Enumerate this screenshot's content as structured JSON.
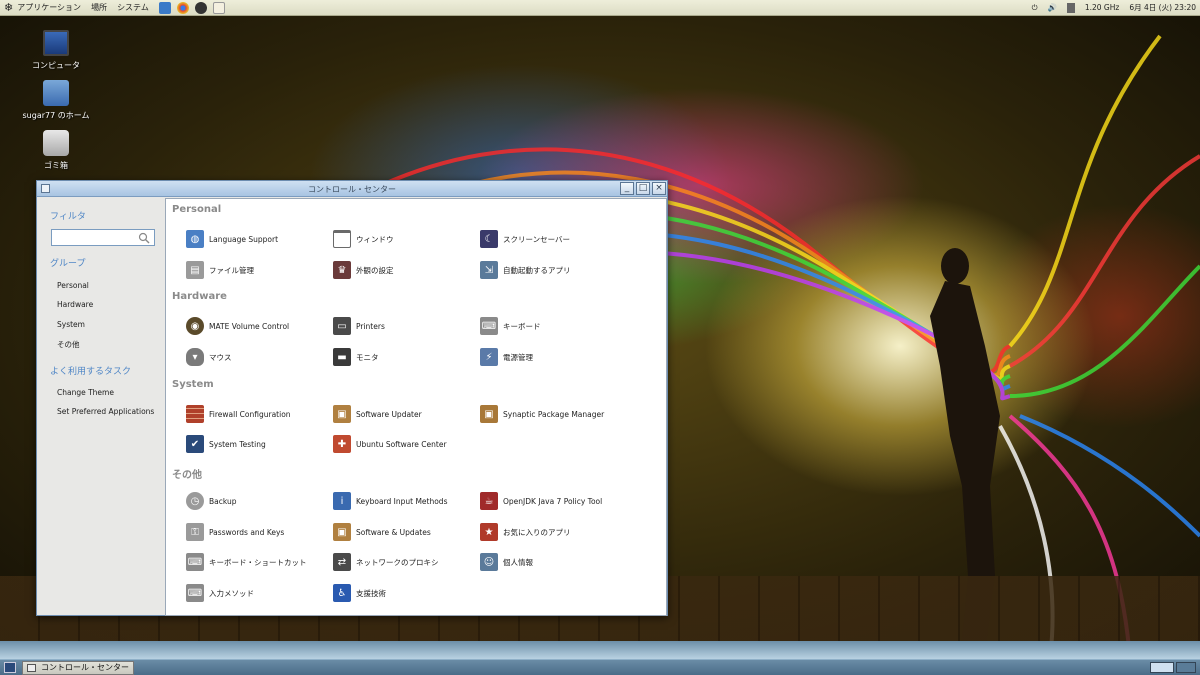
{
  "top_panel": {
    "menus": [
      "アプリケーション",
      "場所",
      "システム"
    ],
    "cpu": "1.20 GHz",
    "datetime": "6月 4日 (火) 23:20"
  },
  "desktop": {
    "icons": [
      {
        "label": "コンピュータ"
      },
      {
        "label": "sugar77 のホーム"
      },
      {
        "label": "ゴミ箱"
      }
    ]
  },
  "window": {
    "title": "コントロール・センター",
    "sidebar": {
      "filter_heading": "フィルタ",
      "filter_value": "",
      "group_heading": "グループ",
      "groups": [
        "Personal",
        "Hardware",
        "System",
        "その他"
      ],
      "tasks_heading": "よく利用するタスク",
      "tasks": [
        "Change Theme",
        "Set Preferred Applications"
      ]
    },
    "categories": [
      {
        "name": "Personal",
        "items": [
          {
            "label": "Language Support",
            "icon": "globe-icon",
            "color": "#4a7fc4"
          },
          {
            "label": "ウィンドウ",
            "icon": "window-icon",
            "color": "#6a6a6a"
          },
          {
            "label": "スクリーンセーバー",
            "icon": "screensaver-icon",
            "color": "#3a3a6a"
          },
          {
            "label": "ファイル管理",
            "icon": "file-cabinet-icon",
            "color": "#9a9a9a"
          },
          {
            "label": "外観の設定",
            "icon": "appearance-icon",
            "color": "#6a3a3a"
          },
          {
            "label": "自動起動するアプリ",
            "icon": "startup-apps-icon",
            "color": "#5a7a9a"
          }
        ]
      },
      {
        "name": "Hardware",
        "items": [
          {
            "label": "MATE Volume Control",
            "icon": "speaker-icon",
            "color": "#5a4a2a"
          },
          {
            "label": "Printers",
            "icon": "printer-icon",
            "color": "#4a4a4a"
          },
          {
            "label": "キーボード",
            "icon": "keyboard-icon",
            "color": "#8a8a8a"
          },
          {
            "label": "マウス",
            "icon": "mouse-icon",
            "color": "#7a7a7a"
          },
          {
            "label": "モニタ",
            "icon": "monitor-icon",
            "color": "#3a3a3a"
          },
          {
            "label": "電源管理",
            "icon": "power-management-icon",
            "color": "#5a7aa8"
          }
        ]
      },
      {
        "name": "System",
        "items": [
          {
            "label": "Firewall Configuration",
            "icon": "firewall-icon",
            "color": "#b0402a"
          },
          {
            "label": "Software Updater",
            "icon": "software-updater-icon",
            "color": "#b08040"
          },
          {
            "label": "Synaptic Package Manager",
            "icon": "package-icon",
            "color": "#a87838"
          },
          {
            "label": "System Testing",
            "icon": "system-testing-icon",
            "color": "#2a4a7a"
          },
          {
            "label": "Ubuntu Software Center",
            "icon": "software-center-icon",
            "color": "#c04a30"
          }
        ]
      },
      {
        "name": "その他",
        "items": [
          {
            "label": "Backup",
            "icon": "backup-icon",
            "color": "#9a9a9a"
          },
          {
            "label": "Keyboard Input Methods",
            "icon": "info-icon",
            "color": "#3a6ab0"
          },
          {
            "label": "OpenJDK Java 7 Policy Tool",
            "icon": "java-icon",
            "color": "#a02a2a"
          },
          {
            "label": "Passwords and Keys",
            "icon": "keys-icon",
            "color": "#9a9a9a"
          },
          {
            "label": "Software & Updates",
            "icon": "software-updates-icon",
            "color": "#b08040"
          },
          {
            "label": "お気に入りのアプリ",
            "icon": "favorite-apps-icon",
            "color": "#b03a2a"
          },
          {
            "label": "キーボード・ショートカット",
            "icon": "keyboard-shortcut-icon",
            "color": "#8a8a8a"
          },
          {
            "label": "ネットワークのプロキシ",
            "icon": "network-proxy-icon",
            "color": "#4a4a4a"
          },
          {
            "label": "個人情報",
            "icon": "personal-info-icon",
            "color": "#5a7a9a"
          },
          {
            "label": "入力メソッド",
            "icon": "input-method-icon",
            "color": "#8a8a8a"
          },
          {
            "label": "支援技術",
            "icon": "accessibility-icon",
            "color": "#2a5ab0"
          }
        ]
      }
    ]
  },
  "bottom_panel": {
    "task": "コントロール・センター"
  }
}
